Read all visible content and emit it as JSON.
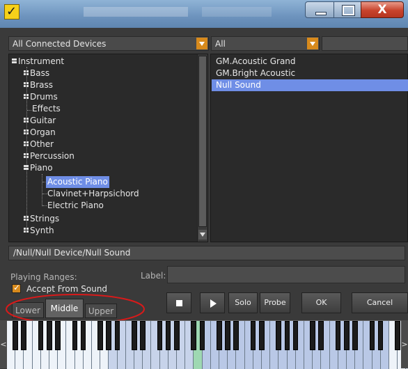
{
  "window": {
    "close_glyph": "X",
    "app_icon_glyph": "✓"
  },
  "devices": {
    "selected": "All Connected Devices"
  },
  "filter": {
    "selected": "All",
    "search_value": ""
  },
  "tree": {
    "root": "Instrument",
    "items": [
      {
        "label": "Bass",
        "expandable": true
      },
      {
        "label": "Brass",
        "expandable": true
      },
      {
        "label": "Drums",
        "expandable": true
      },
      {
        "label": "Effects",
        "expandable": false
      },
      {
        "label": "Guitar",
        "expandable": true
      },
      {
        "label": "Organ",
        "expandable": true
      },
      {
        "label": "Other",
        "expandable": true
      },
      {
        "label": "Percussion",
        "expandable": true
      },
      {
        "label": "Piano",
        "expandable": true,
        "expanded": true
      },
      {
        "label": "Strings",
        "expandable": true
      },
      {
        "label": "Synth",
        "expandable": true
      }
    ],
    "piano_children": [
      "Acoustic Piano",
      "Clavinet+Harpsichord",
      "Electric Piano"
    ],
    "selected_child": "Acoustic Piano"
  },
  "sounds": {
    "items": [
      "GM.Acoustic Grand",
      "GM.Bright Acoustic",
      "Null Sound"
    ],
    "selected": "Null Sound"
  },
  "path": "/Null/Null Device/Null Sound",
  "playing_ranges_label": "Playing Ranges:",
  "label_caption": "Label:",
  "label_value": "",
  "accept_from_sound": {
    "label": "Accept From Sound",
    "checked": true
  },
  "range_tabs": [
    {
      "label": "Lower",
      "active": false
    },
    {
      "label": "Middle",
      "active": true
    },
    {
      "label": "Upper",
      "active": false
    }
  ],
  "buttons": {
    "solo": "Solo",
    "probe": "Probe",
    "ok": "OK",
    "cancel": "Cancel"
  },
  "keyboard": {
    "scroll_left": "<",
    "scroll_right": ">"
  },
  "colors": {
    "accent": "#d88a1c",
    "selection": "#6f8ee6",
    "annotation": "#d81a1a"
  }
}
